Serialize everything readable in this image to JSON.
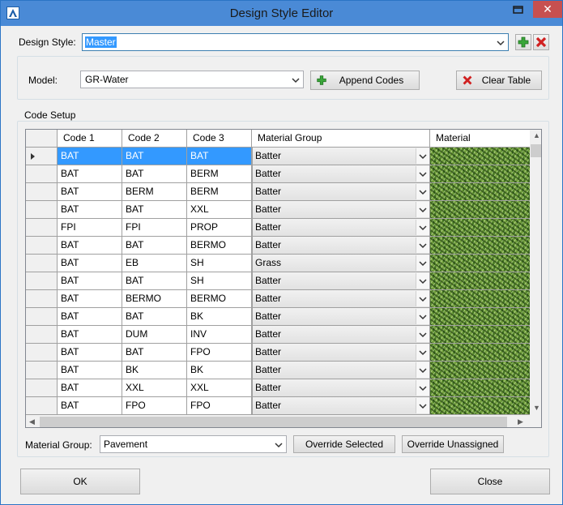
{
  "window": {
    "title": "Design Style Editor"
  },
  "design_style": {
    "label": "Design Style:",
    "value": "Master"
  },
  "model": {
    "label": "Model:",
    "value": "GR-Water",
    "append_label": "Append Codes",
    "clear_label": "Clear Table"
  },
  "code_setup": {
    "title": "Code Setup",
    "columns": [
      "Code 1",
      "Code 2",
      "Code 3",
      "Material Group",
      "Material"
    ],
    "rows": [
      {
        "c1": "BAT",
        "c2": "BAT",
        "c3": "BAT",
        "group": "Batter"
      },
      {
        "c1": "BAT",
        "c2": "BAT",
        "c3": "BERM",
        "group": "Batter"
      },
      {
        "c1": "BAT",
        "c2": "BERM",
        "c3": "BERM",
        "group": "Batter"
      },
      {
        "c1": "BAT",
        "c2": "BAT",
        "c3": "XXL",
        "group": "Batter"
      },
      {
        "c1": "FPI",
        "c2": "FPI",
        "c3": "PROP",
        "group": "Batter"
      },
      {
        "c1": "BAT",
        "c2": "BAT",
        "c3": "BERMO",
        "group": "Batter"
      },
      {
        "c1": "BAT",
        "c2": "EB",
        "c3": "SH",
        "group": "Grass"
      },
      {
        "c1": "BAT",
        "c2": "BAT",
        "c3": "SH",
        "group": "Batter"
      },
      {
        "c1": "BAT",
        "c2": "BERMO",
        "c3": "BERMO",
        "group": "Batter"
      },
      {
        "c1": "BAT",
        "c2": "BAT",
        "c3": "BK",
        "group": "Batter"
      },
      {
        "c1": "BAT",
        "c2": "DUM",
        "c3": "INV",
        "group": "Batter"
      },
      {
        "c1": "BAT",
        "c2": "BAT",
        "c3": "FPO",
        "group": "Batter"
      },
      {
        "c1": "BAT",
        "c2": "BK",
        "c3": "BK",
        "group": "Batter"
      },
      {
        "c1": "BAT",
        "c2": "XXL",
        "c3": "XXL",
        "group": "Batter"
      },
      {
        "c1": "BAT",
        "c2": "FPO",
        "c3": "FPO",
        "group": "Batter"
      }
    ]
  },
  "material_group": {
    "label": "Material Group:",
    "value": "Pavement",
    "override_selected_label": "Override Selected",
    "override_unassigned_label": "Override Unassigned"
  },
  "footer": {
    "ok_label": "OK",
    "close_label": "Close"
  },
  "colors": {
    "selection": "#3399ff",
    "titlebar": "#4a8ad6",
    "close": "#c75050"
  }
}
